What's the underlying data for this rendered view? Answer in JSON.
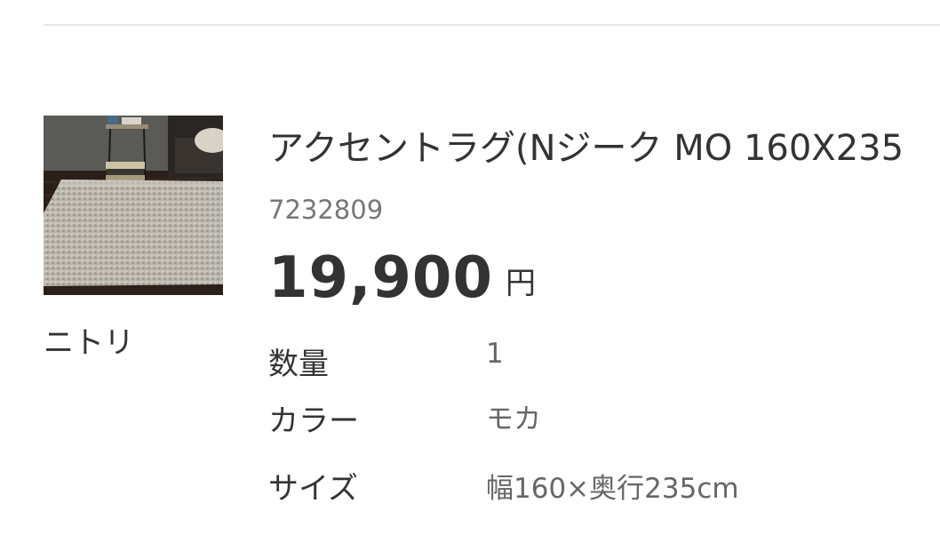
{
  "product": {
    "brand": "ニトリ",
    "title": "アクセントラグ(Nジーク MO 160X235",
    "sku": "7232809",
    "price": "19,900",
    "currency": "円",
    "image_name": "shaggy-rug-product-photo"
  },
  "specs": {
    "quantity": {
      "label": "数量",
      "value": "1"
    },
    "color": {
      "label": "カラー",
      "value": "モカ"
    },
    "size": {
      "label": "サイズ",
      "value": "幅160×奥行235cm"
    }
  }
}
